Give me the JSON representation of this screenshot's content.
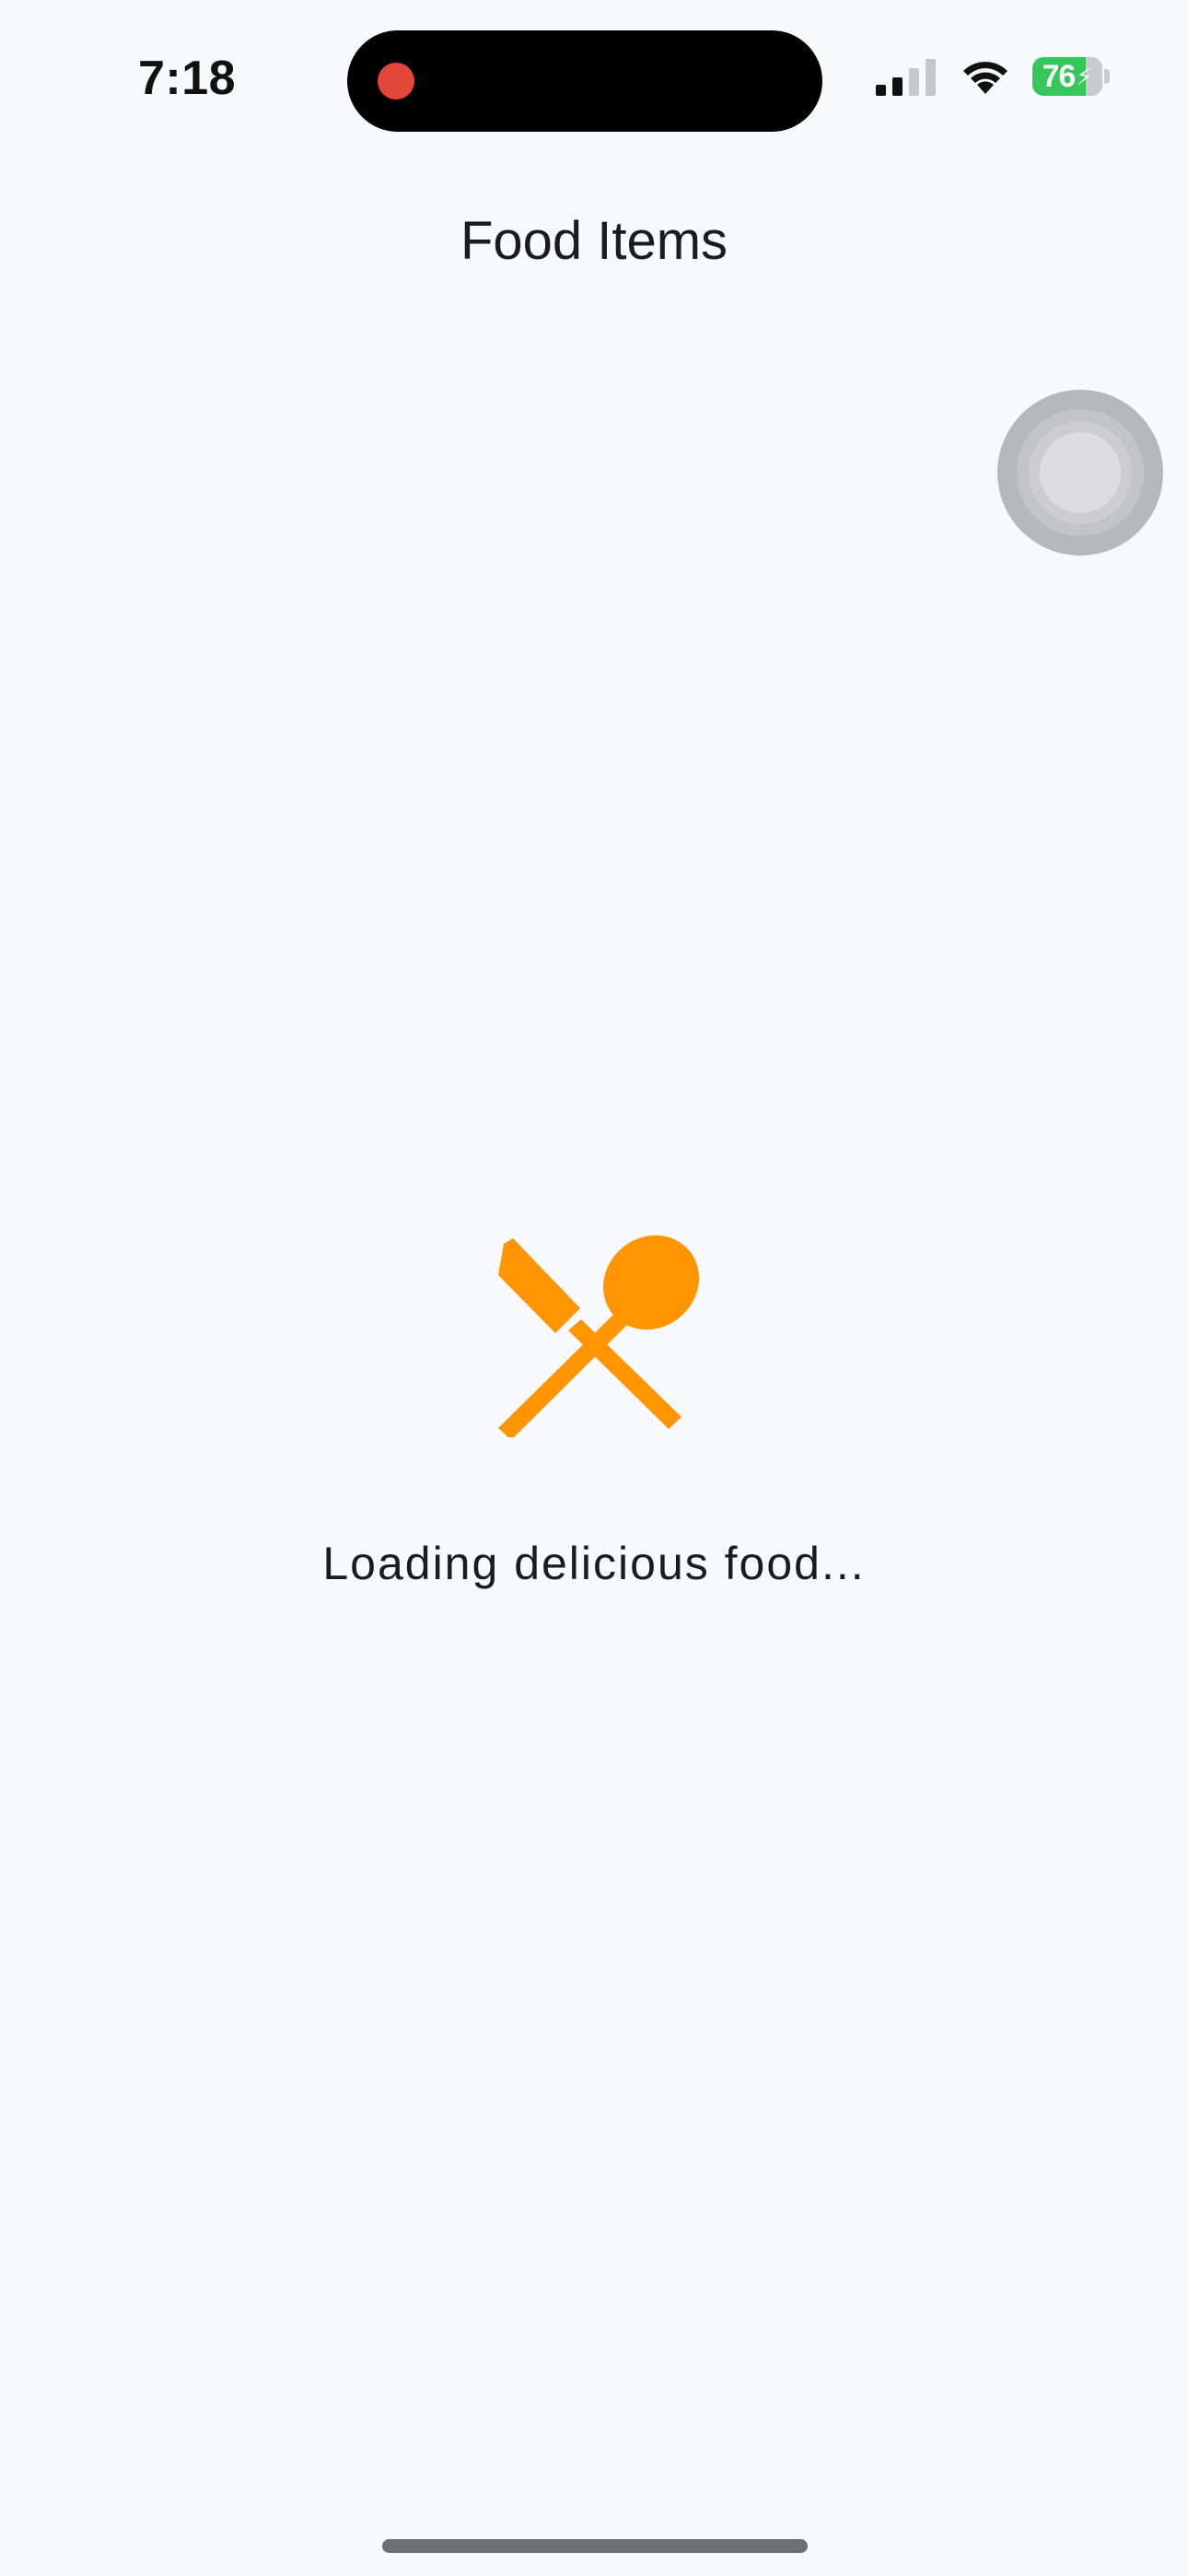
{
  "status_bar": {
    "time": "7:18",
    "battery_level": "76",
    "battery_charging": true,
    "signal_bars_active": 2,
    "signal_bars_total": 4,
    "recording_indicator_color": "#e2473a",
    "battery_color": "#35c759"
  },
  "navigation": {
    "title": "Food Items"
  },
  "loading": {
    "icon": "utensils-crossed-icon",
    "icon_color": "#ff9500",
    "message": "Loading delicious food..."
  },
  "assistive_touch": {
    "icon": "assistive-touch-icon"
  }
}
